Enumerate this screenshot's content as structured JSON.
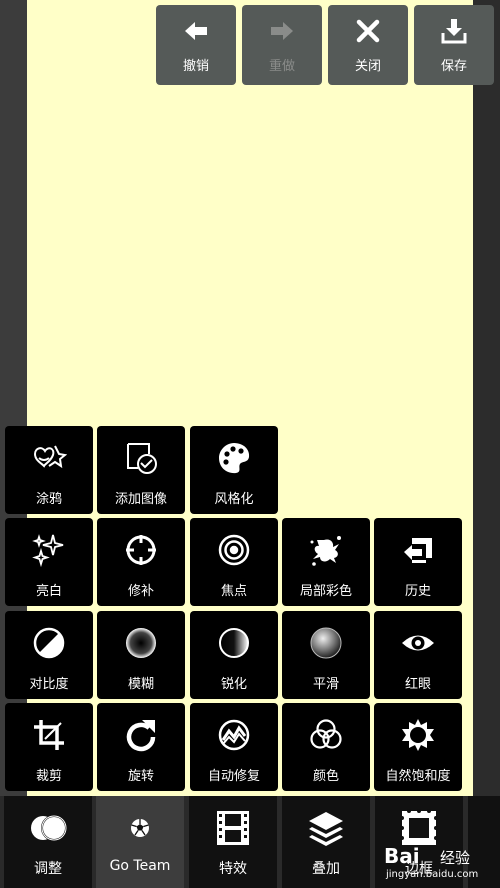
{
  "toolbar": {
    "undo_label": "撤销",
    "redo_label": "重做",
    "close_label": "关闭",
    "save_label": "保存"
  },
  "tools": {
    "row1": [
      "涂鸦",
      "添加图像",
      "风格化"
    ],
    "row2": [
      "亮白",
      "修补",
      "焦点",
      "局部彩色",
      "历史"
    ],
    "row3": [
      "对比度",
      "模糊",
      "锐化",
      "平滑",
      "红眼"
    ],
    "row4": [
      "裁剪",
      "旋转",
      "自动修复",
      "颜色",
      "自然饱和度"
    ]
  },
  "bottom_bar": {
    "items": [
      "调整",
      "Go Team",
      "特效",
      "叠加",
      "边框"
    ],
    "active": "Go Team"
  },
  "watermark": {
    "brand": "Bai",
    "cn": "经验",
    "url": "jingyan.baidu.com"
  },
  "colors": {
    "canvas": "#ffffc8",
    "toolbar_button": "#555a58",
    "tile": "#000000"
  }
}
